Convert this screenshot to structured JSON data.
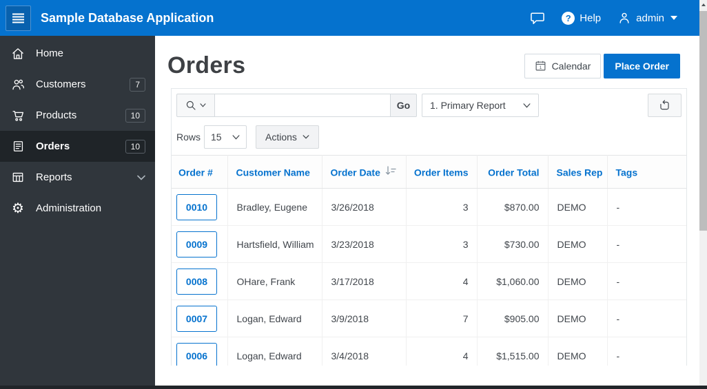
{
  "header": {
    "app_title": "Sample Database Application",
    "help_label": "Help",
    "help_glyph": "?",
    "user_name": "admin"
  },
  "sidebar": {
    "items": [
      {
        "label": "Home"
      },
      {
        "label": "Customers",
        "badge": "7"
      },
      {
        "label": "Products",
        "badge": "10"
      },
      {
        "label": "Orders",
        "badge": "10",
        "active": true
      },
      {
        "label": "Reports",
        "expandable": true
      },
      {
        "label": "Administration"
      }
    ]
  },
  "page": {
    "title": "Orders",
    "calendar_button": "Calendar",
    "calendar_icon_day": "1",
    "place_order_button": "Place Order"
  },
  "report_toolbar": {
    "search_value": "",
    "go_button": "Go",
    "report_select_value": "1. Primary Report",
    "rows_label": "Rows",
    "rows_select_value": "15",
    "actions_button": "Actions"
  },
  "table": {
    "columns": [
      "Order #",
      "Customer Name",
      "Order Date",
      "Order Items",
      "Order Total",
      "Sales Rep",
      "Tags"
    ],
    "sorted_column": "Order Date",
    "sort_direction": "desc",
    "rows": [
      {
        "order_number": "0010",
        "customer_name": "Bradley, Eugene",
        "order_date": "3/26/2018",
        "order_items": "3",
        "order_total": "$870.00",
        "sales_rep": "DEMO",
        "tags": "-"
      },
      {
        "order_number": "0009",
        "customer_name": "Hartsfield, William",
        "order_date": "3/23/2018",
        "order_items": "3",
        "order_total": "$730.00",
        "sales_rep": "DEMO",
        "tags": "-"
      },
      {
        "order_number": "0008",
        "customer_name": "OHare, Frank",
        "order_date": "3/17/2018",
        "order_items": "4",
        "order_total": "$1,060.00",
        "sales_rep": "DEMO",
        "tags": "-"
      },
      {
        "order_number": "0007",
        "customer_name": "Logan, Edward",
        "order_date": "3/9/2018",
        "order_items": "7",
        "order_total": "$905.00",
        "sales_rep": "DEMO",
        "tags": "-"
      },
      {
        "order_number": "0006",
        "customer_name": "Logan, Edward",
        "order_date": "3/4/2018",
        "order_items": "4",
        "order_total": "$1,515.00",
        "sales_rep": "DEMO",
        "tags": "-"
      }
    ]
  },
  "colors": {
    "header_blue": "#0572ce",
    "sidebar_dark": "#30363c",
    "sidebar_active": "#1f2428",
    "accent_blue": "#0572ce",
    "title_gray": "#3e4145"
  }
}
